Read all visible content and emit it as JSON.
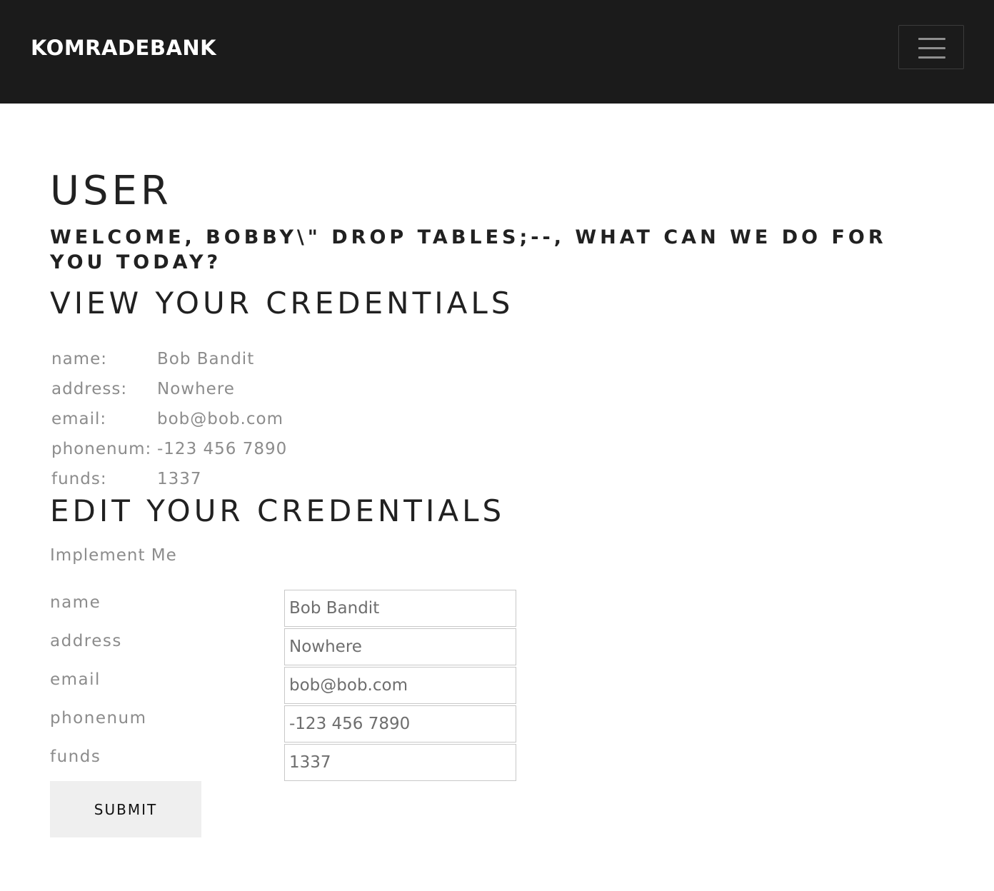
{
  "navbar": {
    "brand": "KOMRADEBANK",
    "menu_icon": "hamburger-menu-icon"
  },
  "page": {
    "title": "USER",
    "welcome": "WELCOME, BOBBY\\\" DROP TABLES;--, WHAT CAN WE DO FOR YOU TODAY?"
  },
  "view": {
    "title": "VIEW YOUR CREDENTIALS",
    "rows": [
      {
        "key": "name:",
        "value": "Bob Bandit"
      },
      {
        "key": "address:",
        "value": "Nowhere"
      },
      {
        "key": "email:",
        "value": "bob@bob.com"
      },
      {
        "key": "phonenum:",
        "value": "-123 456 7890"
      },
      {
        "key": "funds:",
        "value": "1337"
      }
    ]
  },
  "edit": {
    "title": "EDIT YOUR CREDENTIALS",
    "note": "Implement Me",
    "fields": [
      {
        "label": "name",
        "value": "Bob Bandit"
      },
      {
        "label": "address",
        "value": "Nowhere"
      },
      {
        "label": "email",
        "value": "bob@bob.com"
      },
      {
        "label": "phonenum",
        "value": "-123 456 7890"
      },
      {
        "label": "funds",
        "value": "1337"
      }
    ],
    "submit_label": "SUBMIT"
  },
  "colors": {
    "navbar_bg": "#1b1b1b",
    "muted_text": "#8c8c8c",
    "button_bg": "#efefef"
  }
}
